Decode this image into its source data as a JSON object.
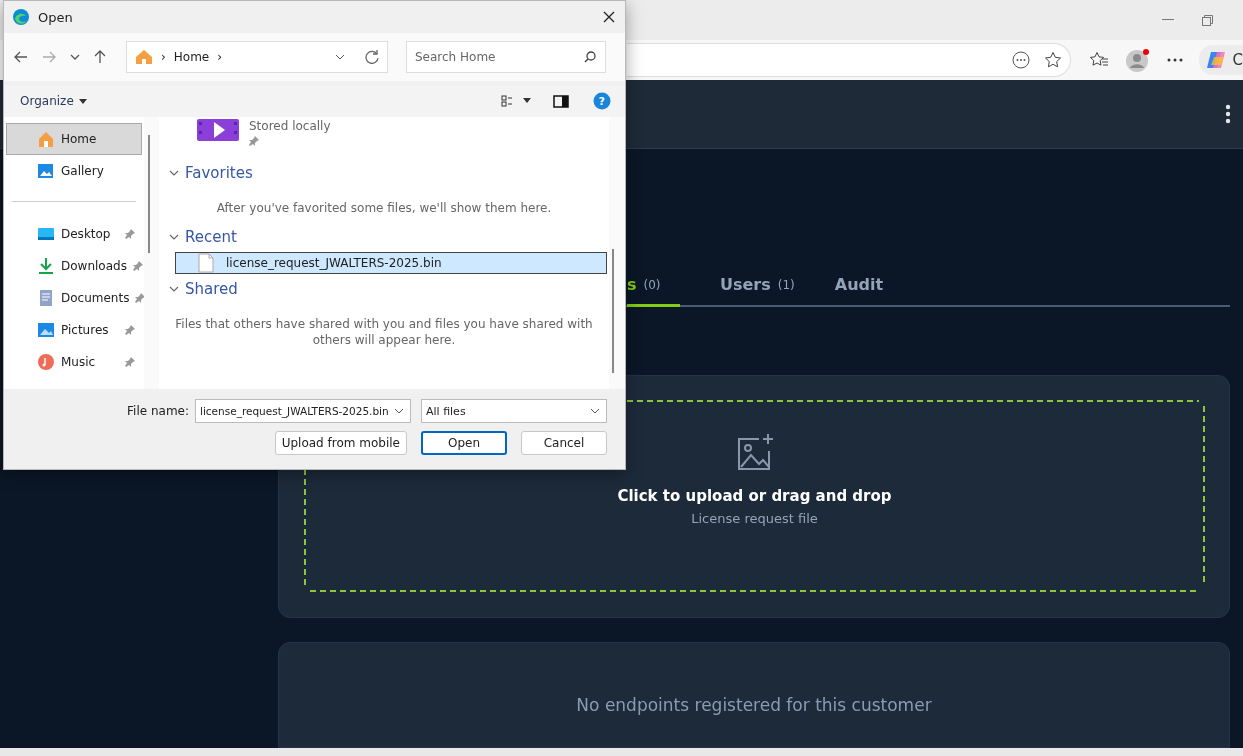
{
  "browser": {
    "copilot_label": "C"
  },
  "app": {
    "tabs": [
      {
        "label": "s",
        "count": "(0)",
        "selected": true
      },
      {
        "label": "Users",
        "count": "(1)",
        "selected": false
      },
      {
        "label": "Audit",
        "selected": false
      }
    ],
    "upload": {
      "title": "Click to upload or drag and drop",
      "subtitle": "License request file"
    },
    "endpoints": {
      "message": "No endpoints registered for this customer"
    }
  },
  "dialog": {
    "title": "Open",
    "path_parts": [
      "›",
      "Home",
      "›"
    ],
    "help": "?",
    "file_name_label": "File name:",
    "search": {
      "placeholder": "Search Home"
    },
    "organize": "Organize",
    "sidebar": {
      "items": [
        {
          "label": "Home",
          "selected": true,
          "pinned": false
        },
        {
          "label": "Gallery",
          "selected": false,
          "pinned": false
        },
        {
          "label": "Desktop",
          "selected": false,
          "pinned": true
        },
        {
          "label": "Downloads",
          "selected": false,
          "pinned": true
        },
        {
          "label": "Documents",
          "selected": false,
          "pinned": true
        },
        {
          "label": "Pictures",
          "selected": false,
          "pinned": true
        },
        {
          "label": "Music",
          "selected": false,
          "pinned": true
        }
      ]
    },
    "top_item": {
      "caption": "Stored locally"
    },
    "sections": [
      {
        "title": "Favorites",
        "message": "After you've favorited some files, we'll show them here."
      },
      {
        "title": "Recent",
        "files": [
          {
            "name": "license_request_JWALTERS-2025.bin",
            "selected": true
          }
        ]
      },
      {
        "title": "Shared",
        "message": "Files that others have shared with you and files you have shared with others will appear here."
      }
    ],
    "file_name": "license_request_JWALTERS-2025.bin",
    "file_type": "All files",
    "buttons": [
      {
        "label": "Upload from mobile",
        "kind": "plain"
      },
      {
        "label": "Open",
        "kind": "default"
      },
      {
        "label": "Cancel",
        "kind": "plain"
      }
    ]
  }
}
